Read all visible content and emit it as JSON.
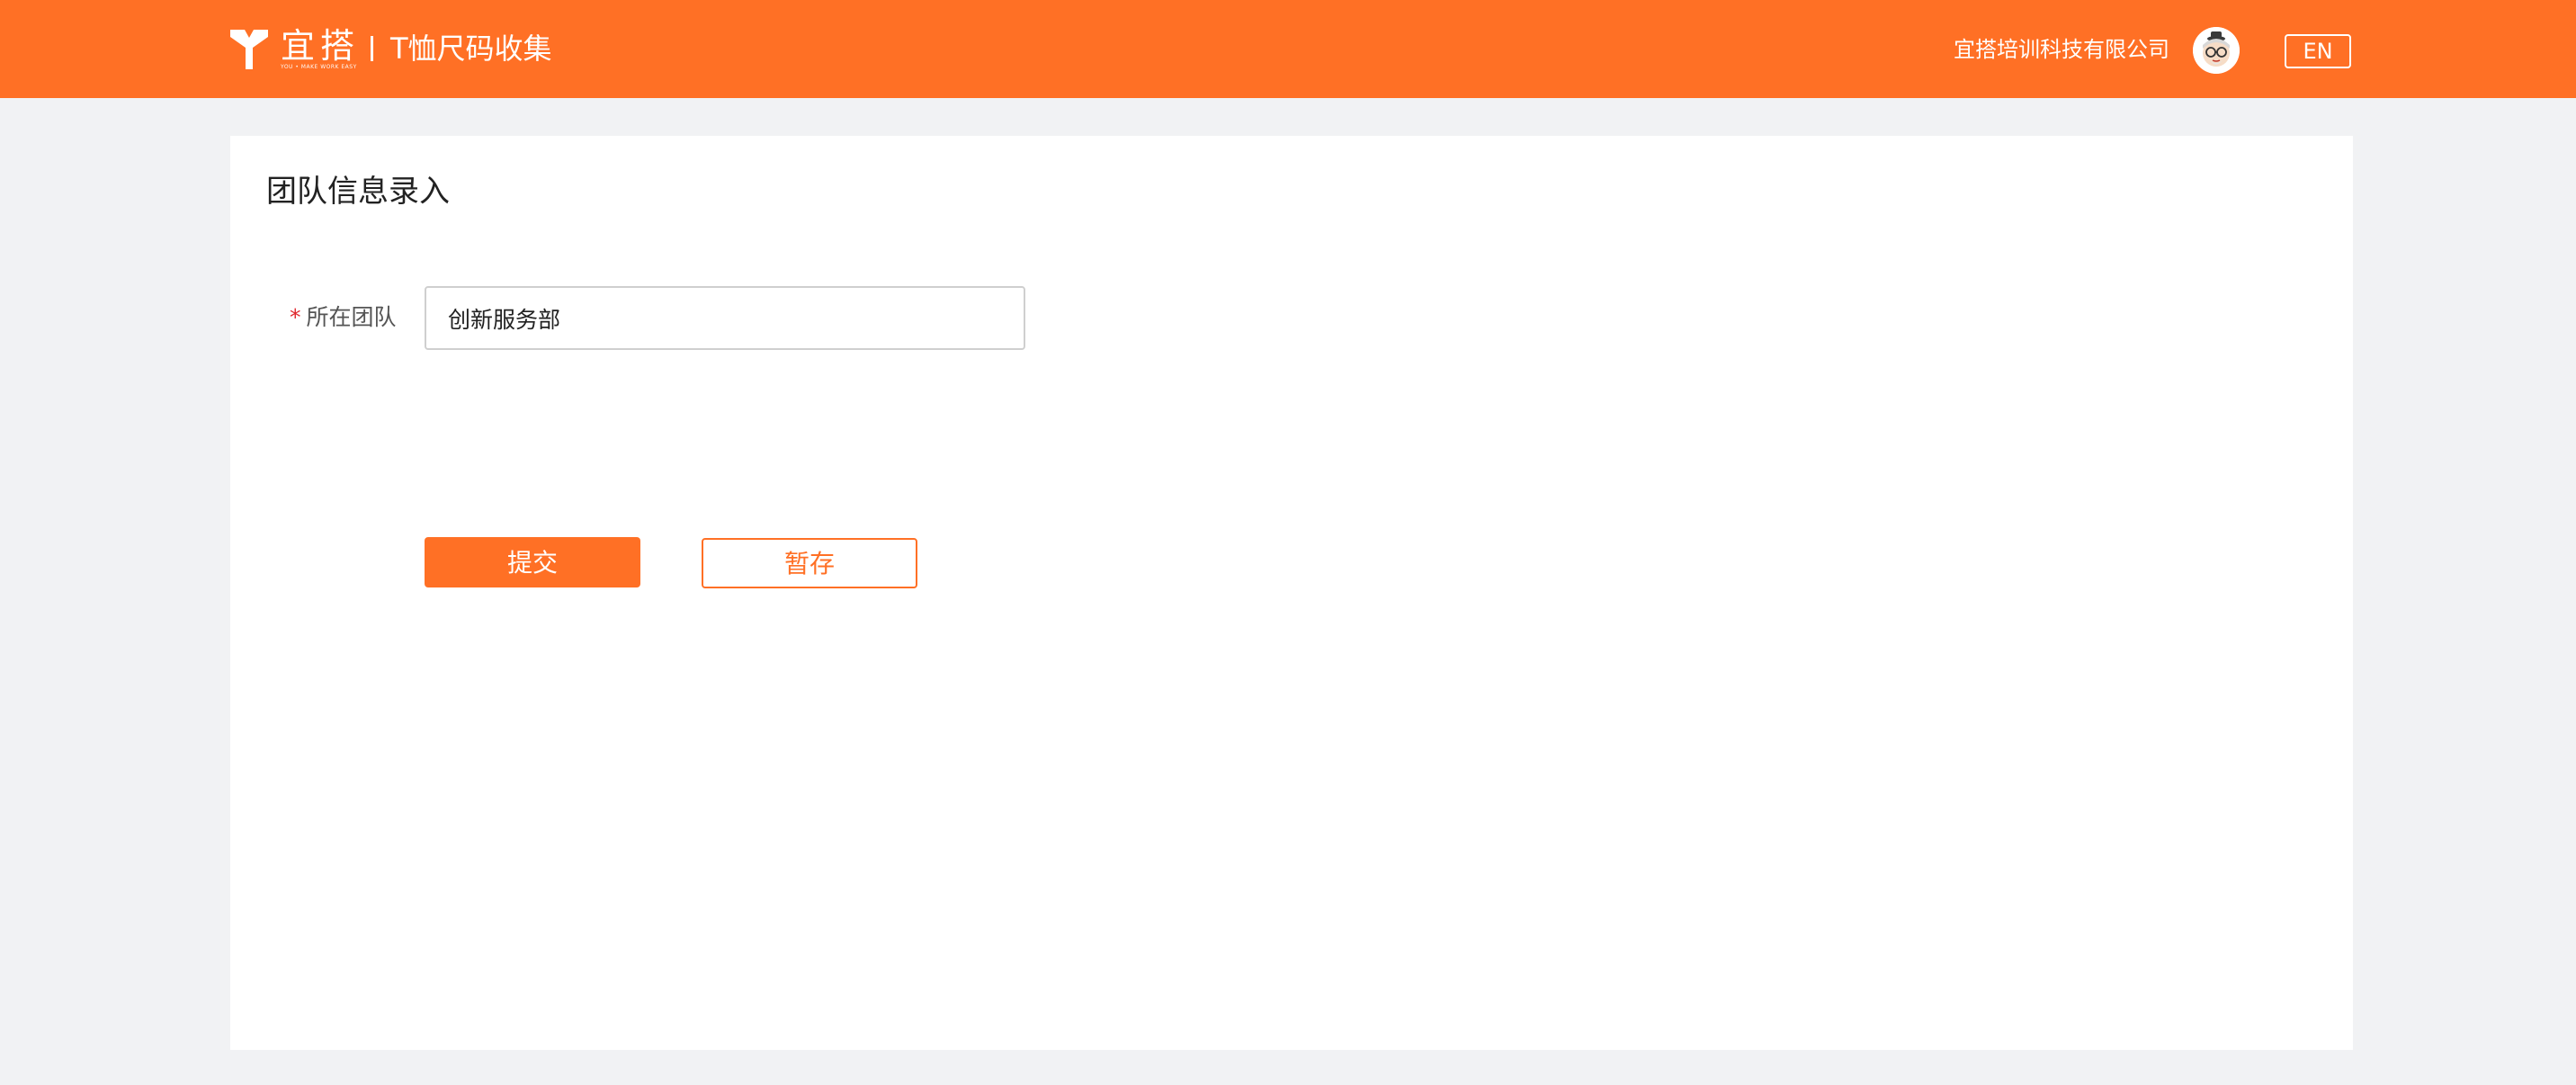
{
  "header": {
    "logo_text": "宜搭",
    "logo_subtext": "YOU • MAKE WORK EASY",
    "app_title": "T恤尺码收集",
    "company": "宜搭培训科技有限公司",
    "avatar_icon": "avatar-face-icon",
    "lang_button": "EN"
  },
  "form": {
    "title": "团队信息录入",
    "fields": [
      {
        "label": "所在团队",
        "required_mark": "*",
        "value": "创新服务部"
      }
    ],
    "submit_label": "提交",
    "save_label": "暂存"
  },
  "colors": {
    "brand": "#ff7025",
    "background": "#f1f2f4",
    "required": "#e0282e"
  }
}
